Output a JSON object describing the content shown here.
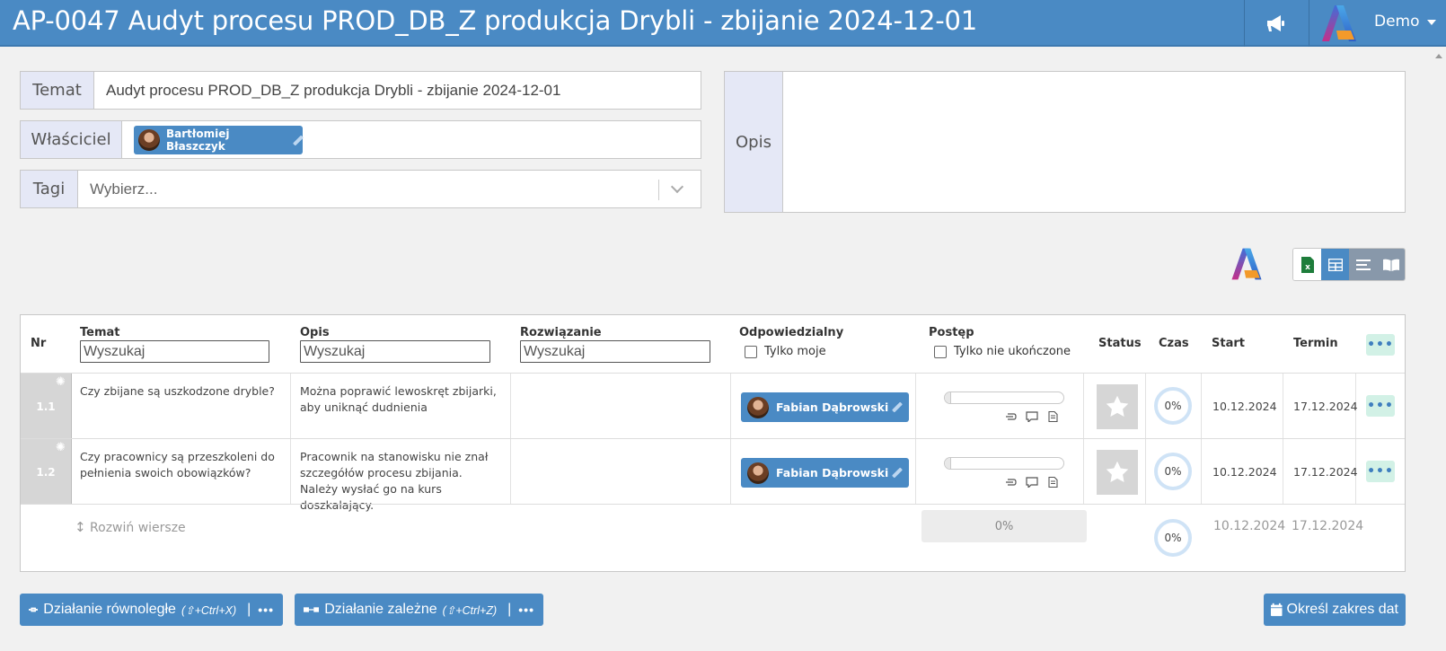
{
  "header": {
    "title": "AP-0047 Audyt procesu PROD_DB_Z produkcja Drybli - zbijanie 2024-12-01",
    "user_label": "Demo"
  },
  "form": {
    "topic_label": "Temat",
    "topic_value": "Audyt procesu PROD_DB_Z produkcja Drybli - zbijanie 2024-12-01",
    "owner_label": "Właściciel",
    "owner_name": "Bartłomiej Błaszczyk",
    "tags_label": "Tagi",
    "tags_placeholder": "Wybierz...",
    "description_label": "Opis"
  },
  "table": {
    "headers": {
      "nr": "Nr",
      "topic": "Temat",
      "description": "Opis",
      "solution": "Rozwiązanie",
      "responsible": "Odpowiedzialny",
      "progress": "Postęp",
      "status": "Status",
      "time": "Czas",
      "start": "Start",
      "deadline": "Termin"
    },
    "search_placeholder": "Wyszukaj",
    "only_mine_label": "Tylko moje",
    "only_unfinished_label": "Tylko nie ukończone",
    "rows": [
      {
        "nr": "1.1",
        "topic": "Czy zbijane są uszkodzone dryble?",
        "description": "Można poprawić lewoskręt zbijarki, aby uniknąć dudnienia",
        "solution": "",
        "responsible": "Fabian Dąbrowski",
        "progress": 0.05,
        "time": "0%",
        "start": "10.12.2024",
        "deadline": "17.12.2024"
      },
      {
        "nr": "1.2",
        "topic": "Czy pracownicy są przeszkoleni do pełnienia swoich obowiązków?",
        "description": "Pracownik na stanowisku nie znał szczegółów procesu zbijania. Należy wysłać go na kurs doszkalający.",
        "solution": "",
        "responsible": "Fabian Dąbrowski",
        "progress": 0.05,
        "time": "0%",
        "start": "10.12.2024",
        "deadline": "17.12.2024"
      }
    ],
    "summary": {
      "expand_label": "Rozwiń wiersze",
      "progress": "0%",
      "time": "0%",
      "start": "10.12.2024",
      "deadline": "17.12.2024"
    }
  },
  "buttons": {
    "parallel": "Działanie równoległe",
    "parallel_shortcut": "(⇧+Ctrl+X)",
    "dependent": "Działanie zależne",
    "dependent_shortcut": "(⇧+Ctrl+Z)",
    "date_range": "Określ zakres dat"
  },
  "colors": {
    "primary": "#4a8ac4",
    "label_bg": "#e5e8f6",
    "menu_btn": "#d2f1e6"
  },
  "icons": {
    "megaphone": "megaphone-icon",
    "excel": "excel-icon",
    "grid": "grid-view-icon",
    "list": "list-view-icon",
    "book": "book-view-icon",
    "star": "star-icon",
    "calendar": "calendar-icon"
  }
}
